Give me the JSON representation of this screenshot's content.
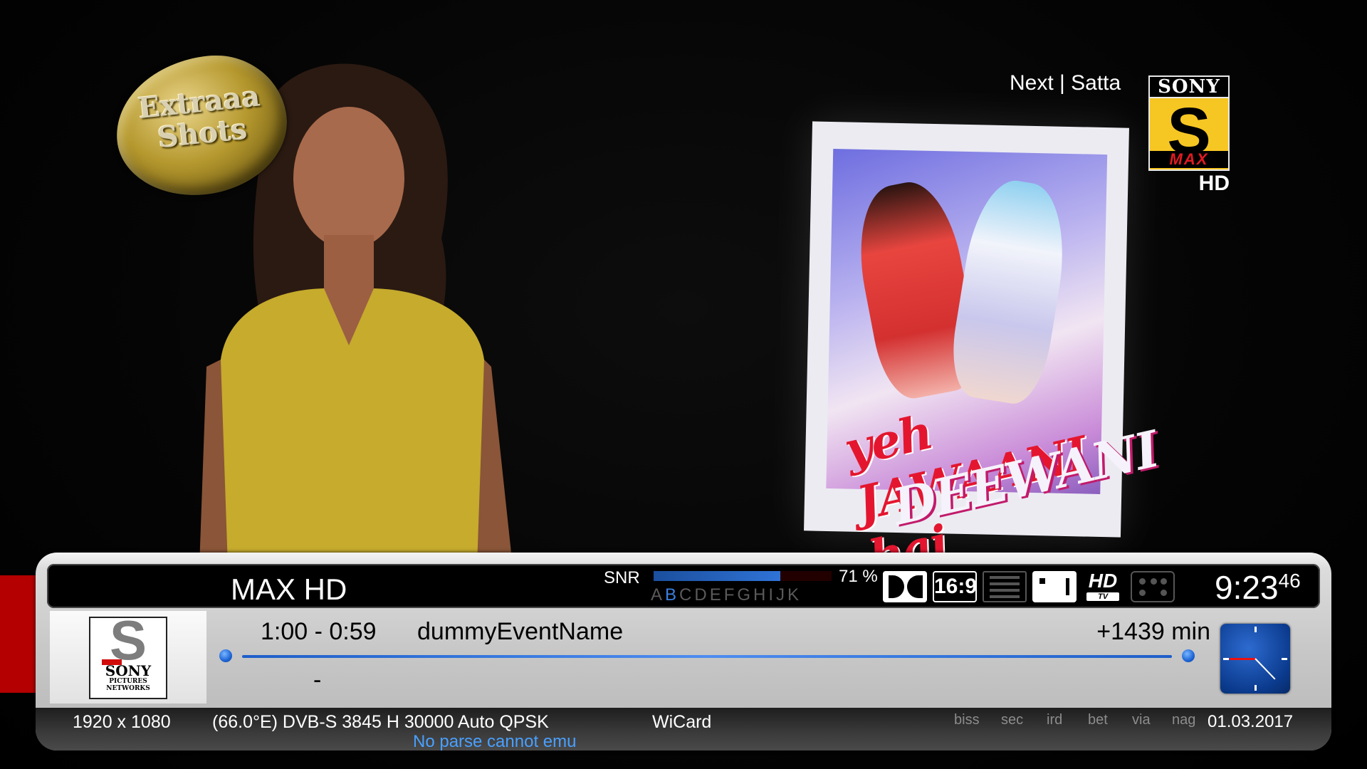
{
  "watermark": {
    "line1": "Extraaa",
    "line2": "Shots"
  },
  "up_next": "Next | Satta",
  "channel_logo": {
    "brand": "SONY",
    "name": "MAX",
    "quality": "HD"
  },
  "poster": {
    "title_line1": "yeh JAWAANI hai",
    "title_line2": "DEEWANI"
  },
  "infobar": {
    "channel_name": "MAX HD",
    "snr_label": "SNR",
    "snr_percent": "71 %",
    "snr_value": 0.71,
    "letters_pre": "A",
    "letters_active": "B",
    "letters_post": "CDEFGHIJK",
    "icons": {
      "aspect": "16:9",
      "hd": "HD",
      "hd_tv": "TV"
    },
    "clock": {
      "hm": "9:23",
      "sec": "46"
    },
    "picon": {
      "brand": "SONY",
      "sub": "PICTURES NETWORKS"
    },
    "event": {
      "time": "1:00 -  0:59",
      "name": "dummyEventName",
      "remaining": "+1439 min",
      "progress": 1.0
    },
    "next_event": {
      "time": "-"
    },
    "bottom": {
      "resolution": "1920 x 1080",
      "tuner": "(66.0°E) DVB-S 3845 H 30000 Auto QPSK",
      "emu_status": "No parse cannot emu",
      "card": "WiCard",
      "caids": [
        "biss",
        "sec",
        "ird",
        "bet",
        "via",
        "nag"
      ],
      "date": "01.03.2017"
    }
  },
  "colors": {
    "accent_blue": "#2f73d6",
    "emu_blue": "#49a0ff",
    "stripe_red": "#b40000"
  }
}
